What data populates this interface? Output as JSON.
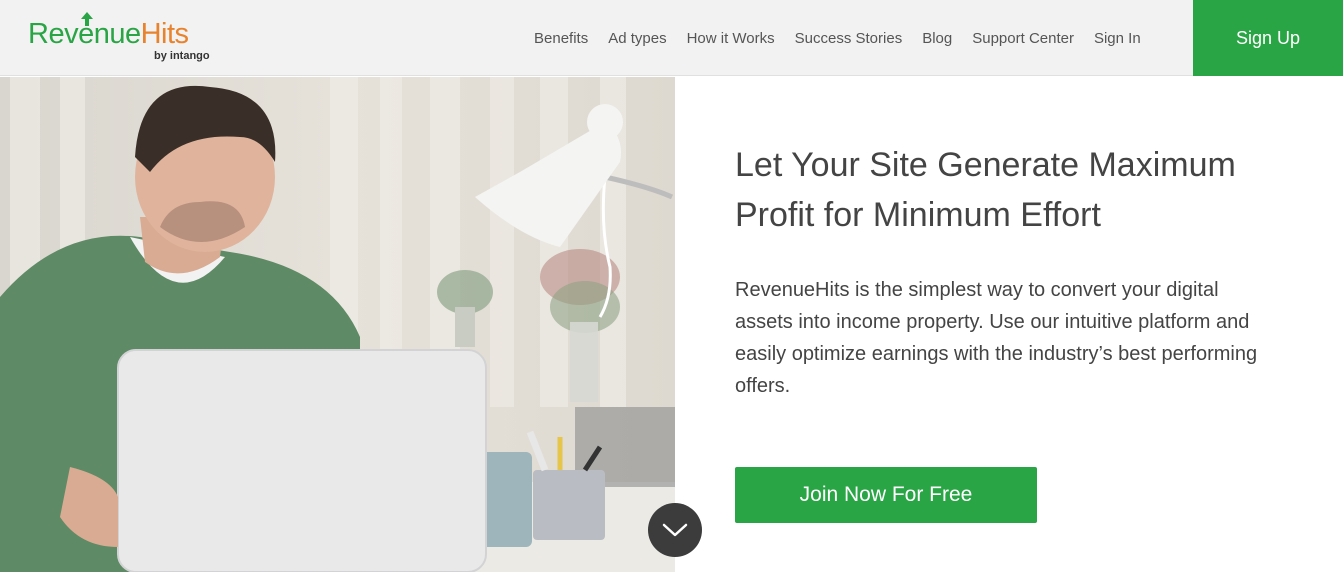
{
  "brand": {
    "name_part1": "Revenue",
    "name_part2": "Hits",
    "tagline": "by intango",
    "primary_color": "#2aa546",
    "accent_color": "#e8822d"
  },
  "nav": {
    "items": [
      "Benefits",
      "Ad types",
      "How it Works",
      "Success Stories",
      "Blog",
      "Support Center",
      "Sign In"
    ],
    "signup_label": "Sign Up"
  },
  "hero": {
    "headline": "Let Your Site Generate Maximum Profit for Minimum Effort",
    "description": "RevenueHits is the simplest way to convert your digital assets into income property. Use our intuitive platform and easily optimize earnings with the industry’s best performing offers.",
    "cta_label": "Join Now For Free",
    "image_alt": "man-working-on-laptop-photo",
    "scroll_icon": "chevron-down-icon"
  }
}
